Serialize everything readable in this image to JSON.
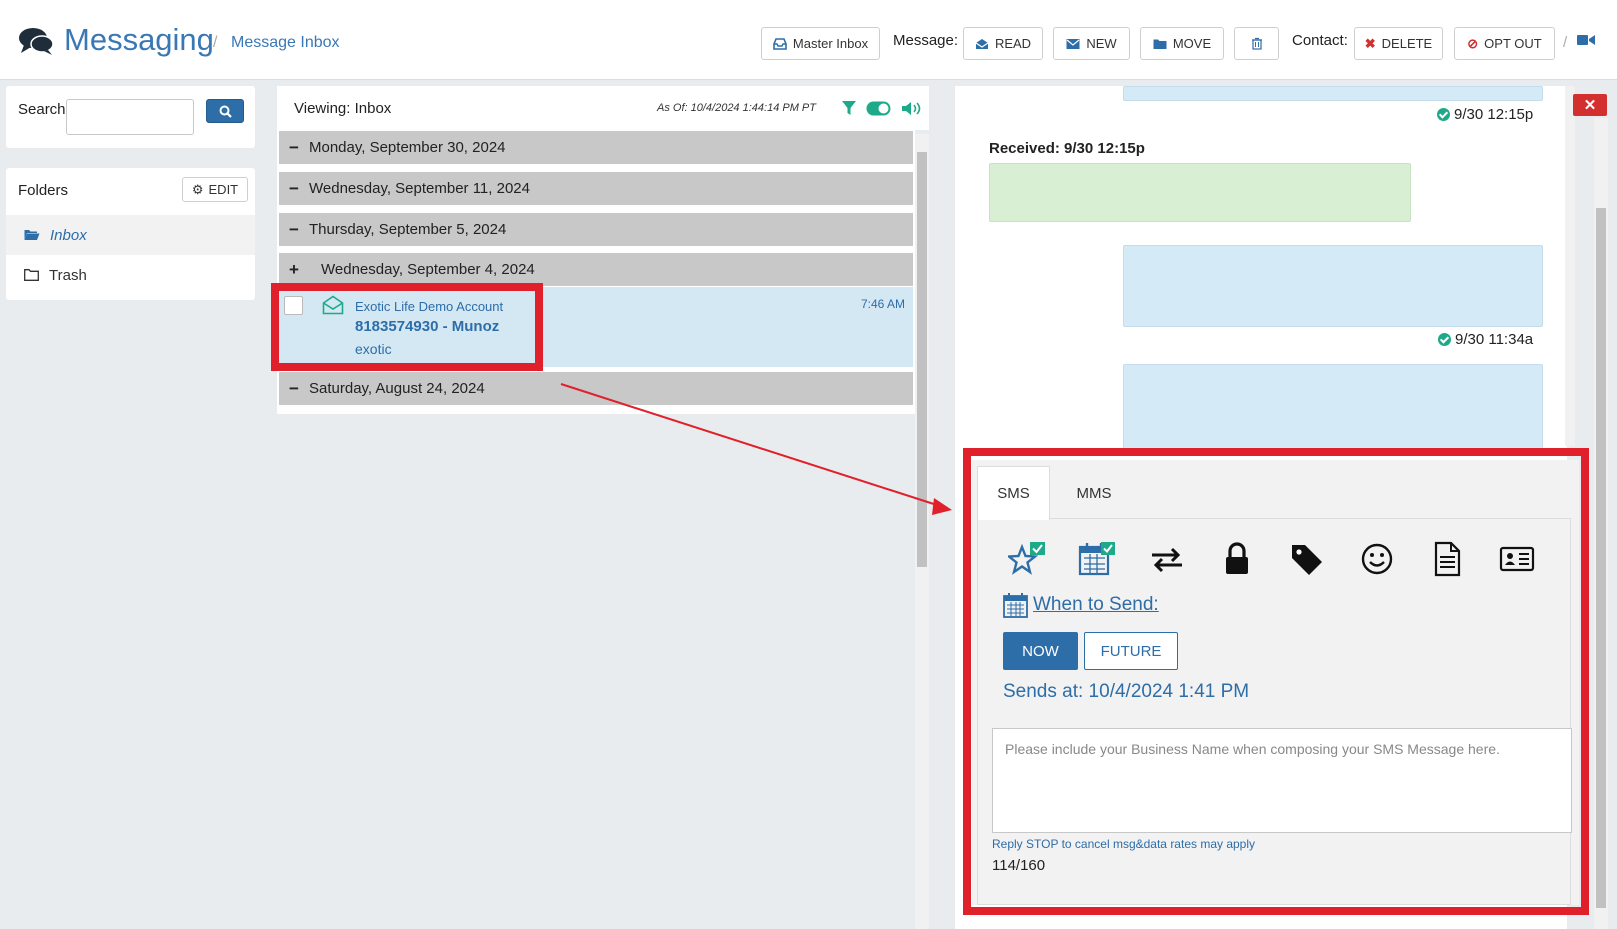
{
  "app": {
    "title": "Messaging",
    "breadcrumb_sep": "/",
    "breadcrumb": "Message Inbox"
  },
  "toolbar": {
    "master_inbox": "Master Inbox",
    "message_label": "Message:",
    "read": "READ",
    "new": "NEW",
    "move": "MOVE",
    "contact_label": "Contact:",
    "delete": "DELETE",
    "opt_out": "OPT OUT"
  },
  "sidebar": {
    "search_label": "Search",
    "folders_title": "Folders",
    "edit_label": "EDIT",
    "folders": [
      {
        "label": "Inbox",
        "active": true
      },
      {
        "label": "Trash",
        "active": false
      }
    ]
  },
  "inbox": {
    "viewing": "Viewing: Inbox",
    "as_of": "As Of: 10/4/2024 1:44:14 PM PT",
    "groups": [
      {
        "sym": "−",
        "date": "Monday, September 30, 2024"
      },
      {
        "sym": "−",
        "date": "Wednesday, September 11, 2024"
      },
      {
        "sym": "−",
        "date": "Thursday, September 5, 2024"
      },
      {
        "sym": "+",
        "date": "Wednesday, September 4, 2024"
      },
      {
        "sym": "−",
        "date": "Saturday, August 24, 2024"
      }
    ],
    "message": {
      "account": "Exotic Life Demo Account",
      "contact": "8183574930 - Munoz",
      "snippet": "exotic",
      "time": "7:46 AM"
    }
  },
  "conversation": {
    "close": "✕",
    "ts1": "9/30 12:15p",
    "received_label": "Received: 9/30 12:15p",
    "ts2": "9/30 11:34a"
  },
  "composer": {
    "tabs": [
      "SMS",
      "MMS"
    ],
    "when_to_send": "When to Send:",
    "now": "NOW",
    "future": "FUTURE",
    "sends_at": "Sends at: 10/4/2024 1:41 PM",
    "placeholder": "Please include your Business Name when composing your SMS Message here.",
    "reply_note": "Reply STOP to cancel msg&data rates may apply",
    "counter": "114/160"
  },
  "colors": {
    "brand": "#3a78b5",
    "primary_button": "#2d6da8",
    "selected_row": "#d4e8f3",
    "date_row": "#c8c8c8",
    "annotation": "#e0202a",
    "check": "#1eaa88"
  }
}
